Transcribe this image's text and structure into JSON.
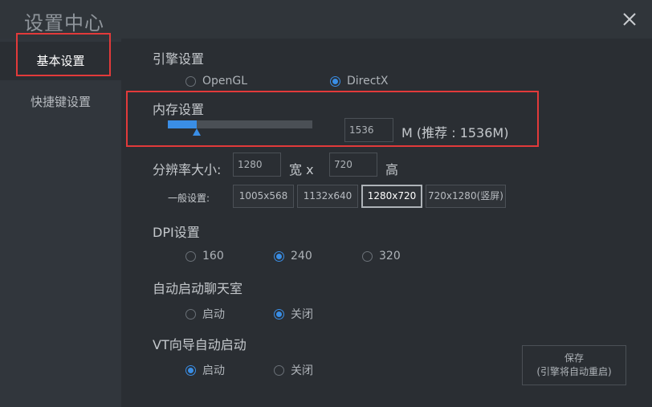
{
  "window": {
    "title": "设置中心",
    "close_icon": "close-icon"
  },
  "sidebar": {
    "items": [
      {
        "label": "基本设置",
        "active": true
      },
      {
        "label": "快捷键设置",
        "active": false
      }
    ]
  },
  "engine": {
    "label": "引擎设置",
    "options": [
      {
        "label": "OpenGL",
        "checked": false
      },
      {
        "label": "DirectX",
        "checked": true
      }
    ]
  },
  "memory": {
    "label": "内存设置",
    "value": "1536",
    "unit_text": "M (推荐 : 1536M)",
    "slider_fraction": 0.2
  },
  "resolution": {
    "label": "分辨率大小:",
    "width_value": "1280",
    "width_sep": "宽 x",
    "height_value": "720",
    "height_unit": "高",
    "presets_label": "一般设置:",
    "presets": [
      {
        "label": "1005x568",
        "selected": false
      },
      {
        "label": "1132x640",
        "selected": false
      },
      {
        "label": "1280x720",
        "selected": true
      },
      {
        "label": "720x1280(竖屏)",
        "selected": false
      }
    ]
  },
  "dpi": {
    "label": "DPI设置",
    "options": [
      {
        "label": "160",
        "checked": false
      },
      {
        "label": "240",
        "checked": true
      },
      {
        "label": "320",
        "checked": false
      }
    ]
  },
  "chatroom": {
    "label": "自动启动聊天室",
    "options": [
      {
        "label": "启动",
        "checked": false
      },
      {
        "label": "关闭",
        "checked": true
      }
    ]
  },
  "vt": {
    "label": "VT向导自动启动",
    "options": [
      {
        "label": "启动",
        "checked": true
      },
      {
        "label": "关闭",
        "checked": false
      }
    ]
  },
  "save": {
    "line1": "保存",
    "line2": "(引擎将自动重启)"
  },
  "colors": {
    "accent": "#3a8ee6",
    "highlight_box": "#e23a3a",
    "background": "#2a2e33"
  }
}
